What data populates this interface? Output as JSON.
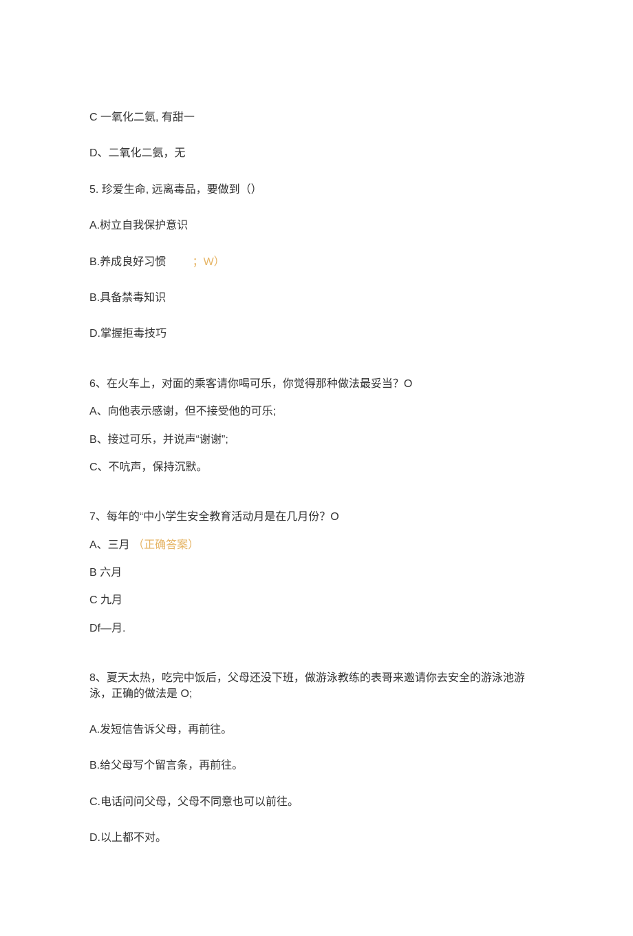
{
  "lines": {
    "l1": "C 一氧化二氨, 有甜一",
    "l2": "D、二氧化二氨，无",
    "l3": "5. 珍爱生命, 远离毒品，要做到（）",
    "l4a": "B.养成良好习惯",
    "l4b": "；W）",
    "l5": "A.树立自我保护意识",
    "l6": "B.具备禁毒知识",
    "l7": "D.掌握拒毒技巧",
    "l8": "6、在火车上，对面的乘客请你喝可乐，你觉得那种做法最妥当？O",
    "l9": "A、向他表示感谢，但不接受他的可乐;",
    "l10": "B、接过可乐，并说声“谢谢”;",
    "l11": "C、不吭声，保持沉默。",
    "l12": "7、每年的“中小学生安全教育活动月是在几月份？O",
    "l13a": "A、三月",
    "l13b": "（正确答案）",
    "l14": "B 六月",
    "l15": "C 九月",
    "l16": "Df—月.",
    "l17": "8、夏天太热，吃完中饭后，父母还没下班，做游泳教练的表哥来邀请你去安全的游泳池游泳，正确的做法是 O;",
    "l18": "A.发短信告诉父母，再前往。",
    "l19": "B.给父母写个留言条，再前往。",
    "l20": "C.电话问问父母，父母不同意也可以前往。",
    "l21": "D.以上都不对。"
  }
}
